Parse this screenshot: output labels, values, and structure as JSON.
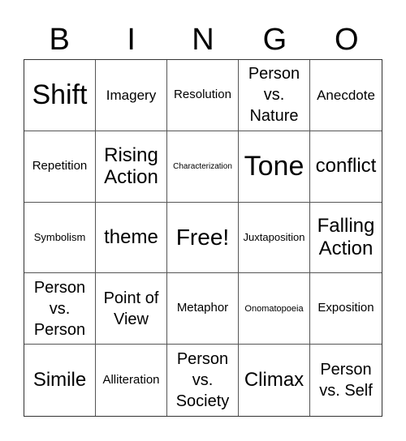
{
  "header": {
    "letters": [
      "B",
      "I",
      "N",
      "G",
      "O"
    ]
  },
  "board": {
    "rows": [
      [
        "Shift",
        "Imagery",
        "Resolution",
        "Person vs. Nature",
        "Anecdote"
      ],
      [
        "Repetition",
        "Rising Action",
        "Characterization",
        "Tone",
        "conflict"
      ],
      [
        "Symbolism",
        "theme",
        "Free!",
        "Juxtaposition",
        "Falling Action"
      ],
      [
        "Person vs. Person",
        "Point of View",
        "Metaphor",
        "Onomatopoeia",
        "Exposition"
      ],
      [
        "Simile",
        "Alliteration",
        "Person vs. Society",
        "Climax",
        "Person vs. Self"
      ]
    ]
  }
}
